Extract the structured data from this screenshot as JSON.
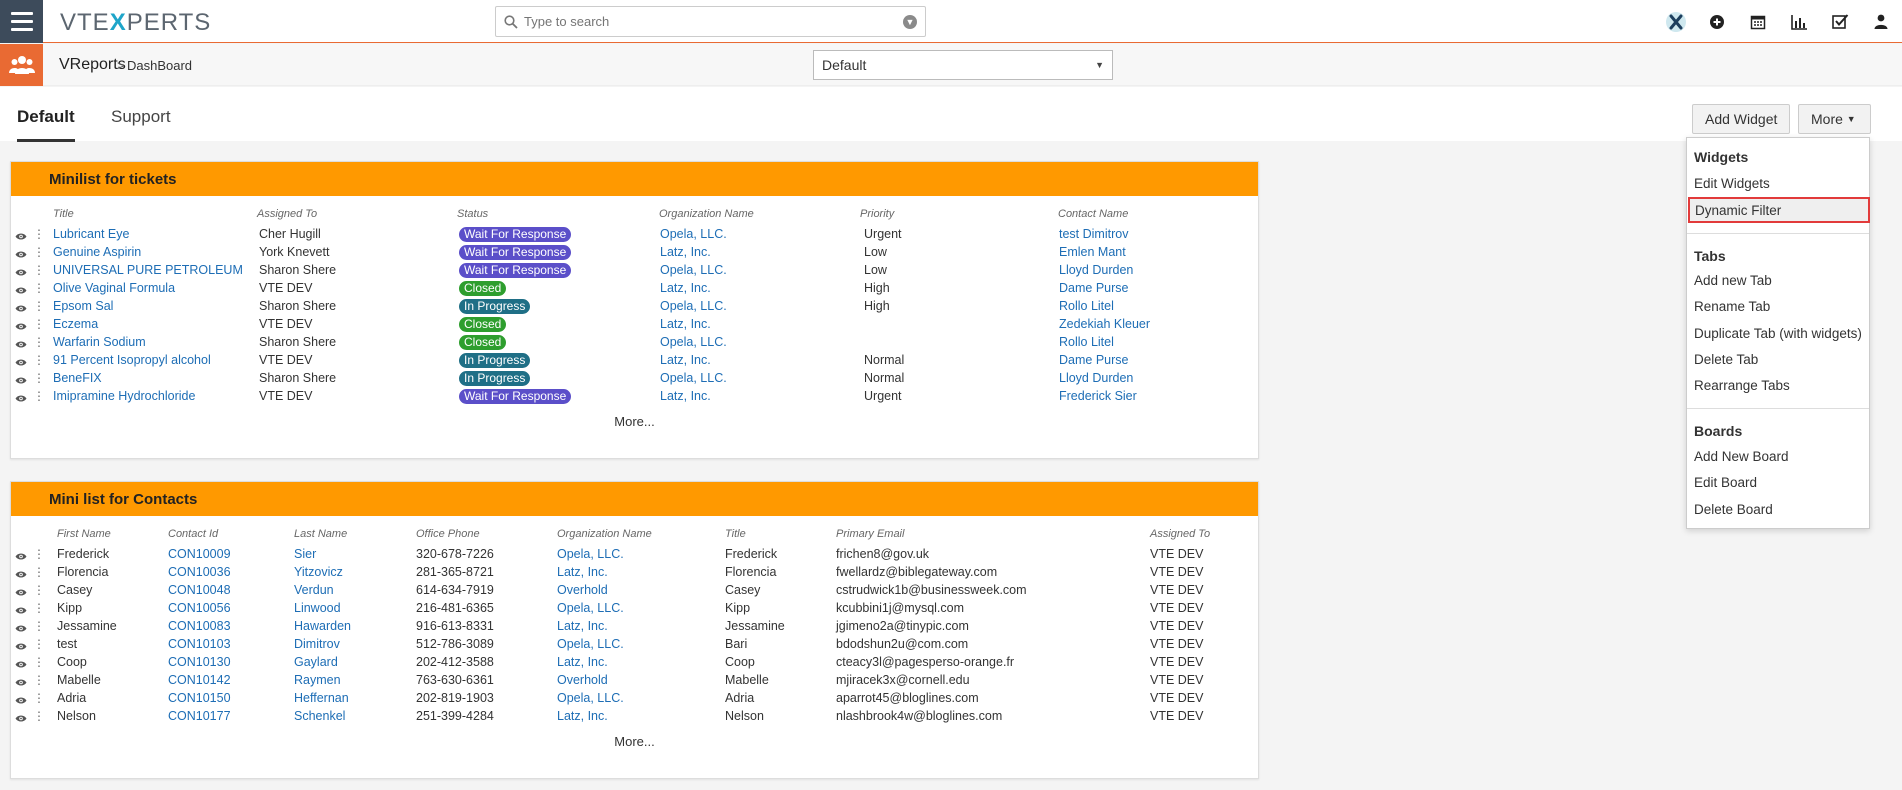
{
  "header": {
    "logo_text_left": "VTE",
    "logo_text_x": "X",
    "logo_text_right": "PERTS",
    "search_placeholder": "Type to search",
    "icons": [
      "vtexperts-x-icon",
      "plus-circle-icon",
      "calendar-icon",
      "bar-chart-icon",
      "checkbox-icon",
      "user-icon"
    ]
  },
  "subbar": {
    "module": "VReports",
    "separator": ">",
    "page": "DashBoard",
    "board_select_value": "Default"
  },
  "tabs": [
    {
      "label": "Default",
      "active": true
    },
    {
      "label": "Support",
      "active": false
    }
  ],
  "actions": {
    "add_widget": "Add Widget",
    "more": "More"
  },
  "menu": {
    "widgets_header": "Widgets",
    "widgets_items": [
      "Edit Widgets",
      "Dynamic Filter"
    ],
    "tabs_header": "Tabs",
    "tabs_items": [
      "Add new Tab",
      "Rename Tab",
      "Duplicate Tab (with widgets)",
      "Delete Tab",
      "Rearrange Tabs"
    ],
    "boards_header": "Boards",
    "boards_items": [
      "Add New Board",
      "Edit Board",
      "Delete Board"
    ],
    "highlighted_item": "Dynamic Filter"
  },
  "tickets_widget": {
    "title": "Minilist for tickets",
    "columns": [
      "Title",
      "Assigned To",
      "Status",
      "Organization Name",
      "Priority",
      "Contact Name"
    ],
    "rows": [
      [
        "Lubricant Eye",
        "Cher Hugill",
        "Wait For Response",
        "Opela, LLC.",
        "Urgent",
        "test Dimitrov"
      ],
      [
        "Genuine Aspirin",
        "York Knevett",
        "Wait For Response",
        "Latz, Inc.",
        "Low",
        "Emlen Mant"
      ],
      [
        "UNIVERSAL PURE PETROLEUM",
        "Sharon Shere",
        "Wait For Response",
        "Opela, LLC.",
        "Low",
        "Lloyd Durden"
      ],
      [
        "Olive Vaginal Formula",
        "VTE DEV",
        "Closed",
        "Latz, Inc.",
        "High",
        "Dame Purse"
      ],
      [
        "Epsom Sal",
        "Sharon Shere",
        "In Progress",
        "Opela, LLC.",
        "High",
        "Rollo Litel"
      ],
      [
        "Eczema",
        "VTE DEV",
        "Closed",
        "Latz, Inc.",
        "",
        "Zedekiah Kleuer"
      ],
      [
        "Warfarin Sodium",
        "Sharon Shere",
        "Closed",
        "Opela, LLC.",
        "",
        "Rollo Litel"
      ],
      [
        "91 Percent Isopropyl alcohol",
        "VTE DEV",
        "In Progress",
        "Latz, Inc.",
        "Normal",
        "Dame Purse"
      ],
      [
        "BeneFIX",
        "Sharon Shere",
        "In Progress",
        "Opela, LLC.",
        "Normal",
        "Lloyd Durden"
      ],
      [
        "Imipramine Hydrochloride",
        "VTE DEV",
        "Wait For Response",
        "Latz, Inc.",
        "Urgent",
        "Frederick Sier"
      ]
    ],
    "more": "More..."
  },
  "contacts_widget": {
    "title": "Mini list for Contacts",
    "columns": [
      "First Name",
      "Contact Id",
      "Last Name",
      "Office Phone",
      "Organization Name",
      "Title",
      "Primary Email",
      "Assigned To"
    ],
    "rows": [
      [
        "Frederick",
        "CON10009",
        "Sier",
        "320-678-7226",
        "Opela, LLC.",
        "Frederick",
        "frichen8@gov.uk",
        "VTE DEV"
      ],
      [
        "Florencia",
        "CON10036",
        "Yitzovicz",
        "281-365-8721",
        "Latz, Inc.",
        "Florencia",
        "fwellardz@biblegateway.com",
        "VTE DEV"
      ],
      [
        "Casey",
        "CON10048",
        "Verdun",
        "614-634-7919",
        "Overhold",
        "Casey",
        "cstrudwick1b@businessweek.com",
        "VTE DEV"
      ],
      [
        "Kipp",
        "CON10056",
        "Linwood",
        "216-481-6365",
        "Opela, LLC.",
        "Kipp",
        "kcubbini1j@mysql.com",
        "VTE DEV"
      ],
      [
        "Jessamine",
        "CON10083",
        "Hawarden",
        "916-613-8331",
        "Latz, Inc.",
        "Jessamine",
        "jgimeno2a@tinypic.com",
        "VTE DEV"
      ],
      [
        "test",
        "CON10103",
        "Dimitrov",
        "512-786-3089",
        "Opela, LLC.",
        "Bari",
        "bdodshun2u@com.com",
        "VTE DEV"
      ],
      [
        "Coop",
        "CON10130",
        "Gaylard",
        "202-412-3588",
        "Latz, Inc.",
        "Coop",
        "cteacy3l@pagesperso-orange.fr",
        "VTE DEV"
      ],
      [
        "Mabelle",
        "CON10142",
        "Raymen",
        "763-630-6361",
        "Overhold",
        "Mabelle",
        "mjiracek3x@cornell.edu",
        "VTE DEV"
      ],
      [
        "Adria",
        "CON10150",
        "Heffernan",
        "202-819-1903",
        "Opela, LLC.",
        "Adria",
        "aparrot45@bloglines.com",
        "VTE DEV"
      ],
      [
        "Nelson",
        "CON10177",
        "Schenkel",
        "251-399-4284",
        "Latz, Inc.",
        "Nelson",
        "nlashbrook4w@bloglines.com",
        "VTE DEV"
      ]
    ],
    "more": "More..."
  },
  "colors": {
    "accent_orange": "#e96a33",
    "widget_header": "#ff9900",
    "link": "#1d6db5",
    "status_wait": "#5b4fc9",
    "status_closed": "#2e9e2e",
    "status_progress": "#1f6f86"
  }
}
